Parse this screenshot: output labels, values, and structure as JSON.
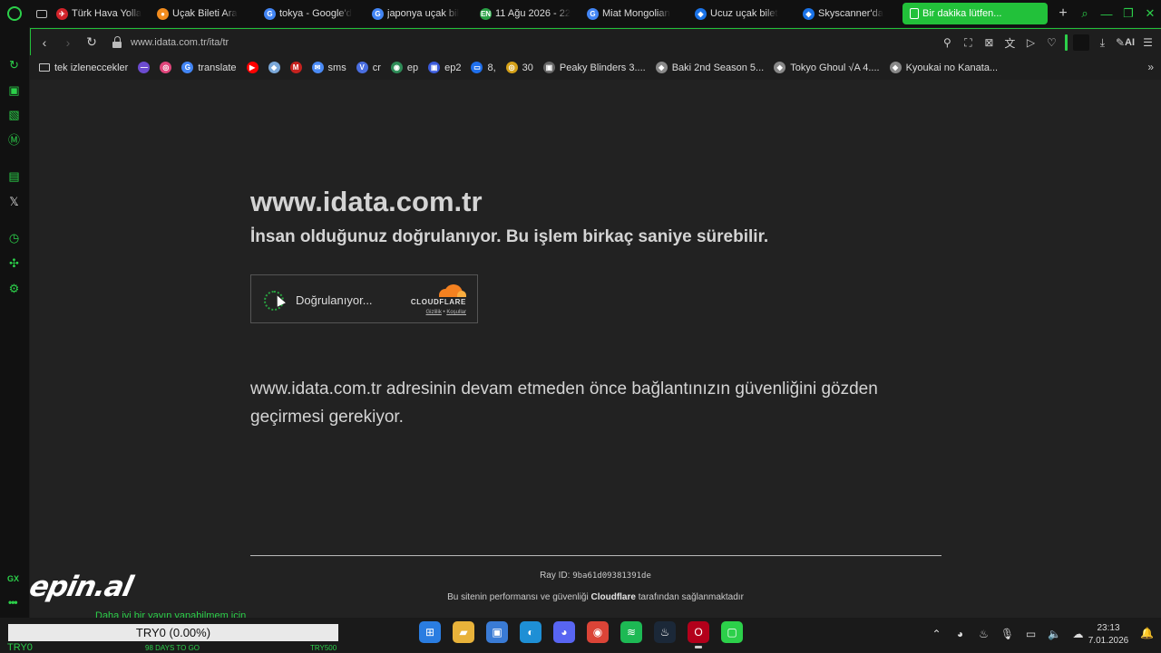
{
  "tabs": [
    {
      "title": "Türk Hava Yolla",
      "fav_color": "#d2232a",
      "glyph": "✈"
    },
    {
      "title": "Uçak Bileti Ara",
      "fav_color": "#f28c1e",
      "glyph": "●"
    },
    {
      "title": "tokya - Google'd",
      "fav_color": "#4285f4",
      "glyph": "G"
    },
    {
      "title": "japonya uçak bil",
      "fav_color": "#4285f4",
      "glyph": "G"
    },
    {
      "title": "11 Ağu 2026 - 22",
      "fav_color": "#2aa146",
      "glyph": "EN"
    },
    {
      "title": "Miat Mongolian",
      "fav_color": "#4285f4",
      "glyph": "G"
    },
    {
      "title": "Ucuz uçak bilet",
      "fav_color": "#1a73e8",
      "glyph": "◆"
    },
    {
      "title": "Skyscanner'da",
      "fav_color": "#1a73e8",
      "glyph": "◆"
    },
    {
      "title": "Bir dakika lütfen...",
      "fav_color": "#ffffff",
      "glyph": "",
      "active": true
    }
  ],
  "address_bar": {
    "url": "www.idata.com.tr/ita/tr",
    "ai_label": "AI"
  },
  "bookmarks": [
    {
      "label": "tek izleneccekler",
      "icon": "folder"
    },
    {
      "label": "",
      "icon_color": "#6c4bd0",
      "glyph": "—"
    },
    {
      "label": "",
      "icon_color": "#e0457b",
      "glyph": "◎"
    },
    {
      "label": "translate",
      "icon_color": "#4285f4",
      "glyph": "G"
    },
    {
      "label": "",
      "icon_color": "#ff0000",
      "glyph": "▶"
    },
    {
      "label": "",
      "icon_color": "#7aa7d8",
      "glyph": "◆"
    },
    {
      "label": "",
      "icon_color": "#c5221f",
      "glyph": "M"
    },
    {
      "label": "sms",
      "icon_color": "#4a8af4",
      "glyph": "✉"
    },
    {
      "label": "cr",
      "icon_color": "#4a6ee0",
      "glyph": "V"
    },
    {
      "label": "ep",
      "icon_color": "#2e8b57",
      "glyph": "◉"
    },
    {
      "label": "ep2",
      "icon_color": "#3b5bdb",
      "glyph": "▣"
    },
    {
      "label": "8,",
      "icon_color": "#1f6feb",
      "glyph": "▭"
    },
    {
      "label": "30",
      "icon_color": "#d4a017",
      "glyph": "◎"
    },
    {
      "label": "Peaky Blinders 3....",
      "icon_color": "#666666",
      "glyph": "▣"
    },
    {
      "label": "Baki 2nd Season 5...",
      "icon_color": "#888888",
      "glyph": "◆"
    },
    {
      "label": "Tokyo Ghoul √A 4....",
      "icon_color": "#888888",
      "glyph": "◆"
    },
    {
      "label": "Kyoukai no Kanata...",
      "icon_color": "#888888",
      "glyph": "◆"
    }
  ],
  "page": {
    "site_title": "www.idata.com.tr",
    "subtitle": "İnsan olduğunuz doğrulanıyor. Bu işlem birkaç saniye sürebilir.",
    "widget": {
      "status_text": "Doğrulanıyor...",
      "brand": "CLOUDFLARE",
      "privacy_link": "Gizlilik",
      "separator": "•",
      "terms_link": "Koşullar"
    },
    "notice": "www.idata.com.tr adresinin devam etmeden önce bağlantınızın güvenliğini gözden geçirmesi gerekiyor.",
    "ray_label": "Ray ID:",
    "ray_id": "9ba61d09381391de",
    "footer_before": "Bu sitenin performansı ve güvenliği",
    "footer_brand": "Cloudflare",
    "footer_after": "tarafından sağlanmaktadır"
  },
  "overlay": {
    "message": "Daha iyi bir yayın yapabilmem için",
    "ticker_value": "TRY0 (0.00%)",
    "ticker_left": "TRY0",
    "ticker_mid": "98 DAYS TO GO",
    "ticker_right": "TRY500",
    "logo_text": "epin.al"
  },
  "taskbar": {
    "time": "23:13",
    "date": "7.01.2026",
    "apps": [
      {
        "name": "windows-start",
        "color": "#2a7de1",
        "glyph": "⊞"
      },
      {
        "name": "file-explorer",
        "color": "#e8b23a",
        "glyph": "▰"
      },
      {
        "name": "microsoft-store",
        "color": "#3a7bd5",
        "glyph": "▣"
      },
      {
        "name": "edge",
        "color": "#1e8fd5",
        "glyph": "◐"
      },
      {
        "name": "discord",
        "color": "#5865f2",
        "glyph": "◕"
      },
      {
        "name": "chrome",
        "color": "#db4437",
        "glyph": "◉"
      },
      {
        "name": "spotify",
        "color": "#1db954",
        "glyph": "≋"
      },
      {
        "name": "steam",
        "color": "#1b2838",
        "glyph": "♨"
      },
      {
        "name": "opera-gx",
        "color": "#b3001b",
        "glyph": "O"
      },
      {
        "name": "green-app",
        "color": "#2cd04a",
        "glyph": "▢"
      }
    ]
  },
  "colors": {
    "accent": "#2cd04a",
    "page_bg": "#222222",
    "cloudflare_orange": "#f48120"
  }
}
